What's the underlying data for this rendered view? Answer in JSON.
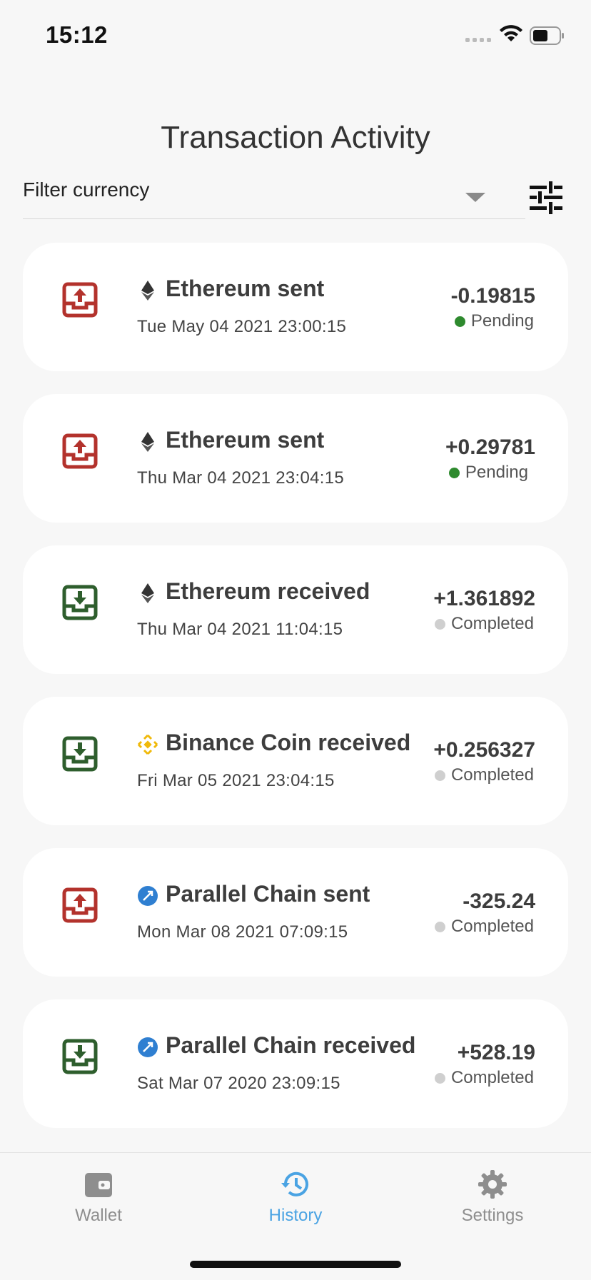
{
  "status_bar": {
    "time": "15:12"
  },
  "page": {
    "title": "Transaction Activity"
  },
  "filter": {
    "placeholder": "Filter currency"
  },
  "colors": {
    "sent": "#b3322c",
    "received": "#2e5e2d",
    "pending": "#2e8a2e",
    "completed": "#cfcfcf",
    "active_tab": "#4aa3e3"
  },
  "transactions": [
    {
      "direction": "sent",
      "coin": "ethereum",
      "title": "Ethereum sent",
      "date": "Tue May 04 2021 23:00:15",
      "amount": "-0.19815",
      "status": "Pending"
    },
    {
      "direction": "sent",
      "coin": "ethereum",
      "title": "Ethereum sent",
      "date": "Thu Mar 04 2021 23:04:15",
      "amount": "+0.29781",
      "status": "Pending"
    },
    {
      "direction": "received",
      "coin": "ethereum",
      "title": "Ethereum received",
      "date": "Thu Mar 04 2021 11:04:15",
      "amount": "+1.361892",
      "status": "Completed"
    },
    {
      "direction": "received",
      "coin": "binance",
      "title": "Binance Coin received",
      "date": "Fri Mar 05 2021 23:04:15",
      "amount": "+0.256327",
      "status": "Completed"
    },
    {
      "direction": "sent",
      "coin": "parallel",
      "title": "Parallel Chain sent",
      "date": "Mon Mar 08 2021 07:09:15",
      "amount": "-325.24",
      "status": "Completed"
    },
    {
      "direction": "received",
      "coin": "parallel",
      "title": "Parallel Chain received",
      "date": "Sat Mar 07 2020 23:09:15",
      "amount": "+528.19",
      "status": "Completed"
    }
  ],
  "tabs": [
    {
      "label": "Wallet",
      "icon": "wallet-icon",
      "active": false
    },
    {
      "label": "History",
      "icon": "history-icon",
      "active": true
    },
    {
      "label": "Settings",
      "icon": "gear-icon",
      "active": false
    }
  ]
}
